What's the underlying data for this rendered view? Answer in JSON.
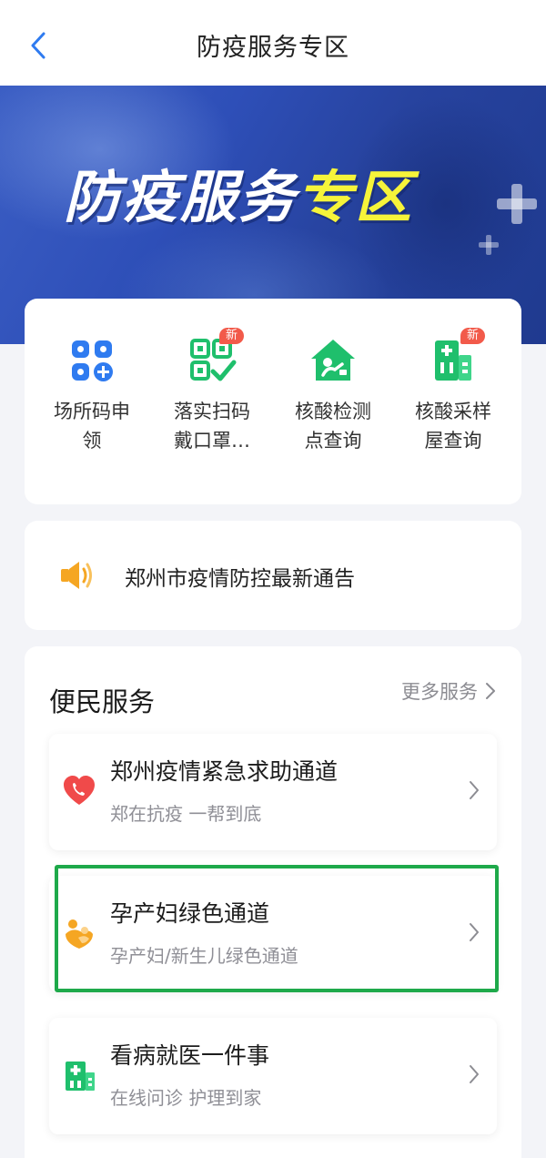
{
  "nav": {
    "title": "防疫服务专区"
  },
  "banner": {
    "title_white": "防疫服务",
    "title_yellow": "专区"
  },
  "quick": {
    "items": [
      {
        "line1": "场所码申",
        "line2": "领",
        "icon": "venue-code-apply-icon"
      },
      {
        "line1": "落实扫码",
        "line2": "戴口罩…",
        "icon": "qr-scan-mask-icon",
        "badge": "新"
      },
      {
        "line1": "核酸检测",
        "line2": "点查询",
        "icon": "testing-site-icon"
      },
      {
        "line1": "核酸采样",
        "line2": "屋查询",
        "icon": "sampling-booth-icon",
        "badge": "新"
      }
    ]
  },
  "notice": {
    "text": "郑州市疫情防控最新通告",
    "icon": "speaker-icon"
  },
  "services": {
    "title": "便民服务",
    "more": "更多服务",
    "items": [
      {
        "title": "郑州疫情紧急求助通道",
        "subtitle": "郑在抗疫 一帮到底",
        "icon": "heart-phone-icon"
      },
      {
        "title": "孕产妇绿色通道",
        "subtitle": "孕产妇/新生儿绿色通道",
        "icon": "mother-baby-icon"
      },
      {
        "title": "看病就医一件事",
        "subtitle": "在线问诊 护理到家",
        "icon": "hospital-icon"
      }
    ]
  },
  "colors": {
    "accent_blue": "#2f7bf0",
    "green": "#1fbf6c",
    "badge_red": "#f25a4a",
    "highlight_green": "#1ea94a",
    "banner_yellow": "#f6f43a"
  }
}
